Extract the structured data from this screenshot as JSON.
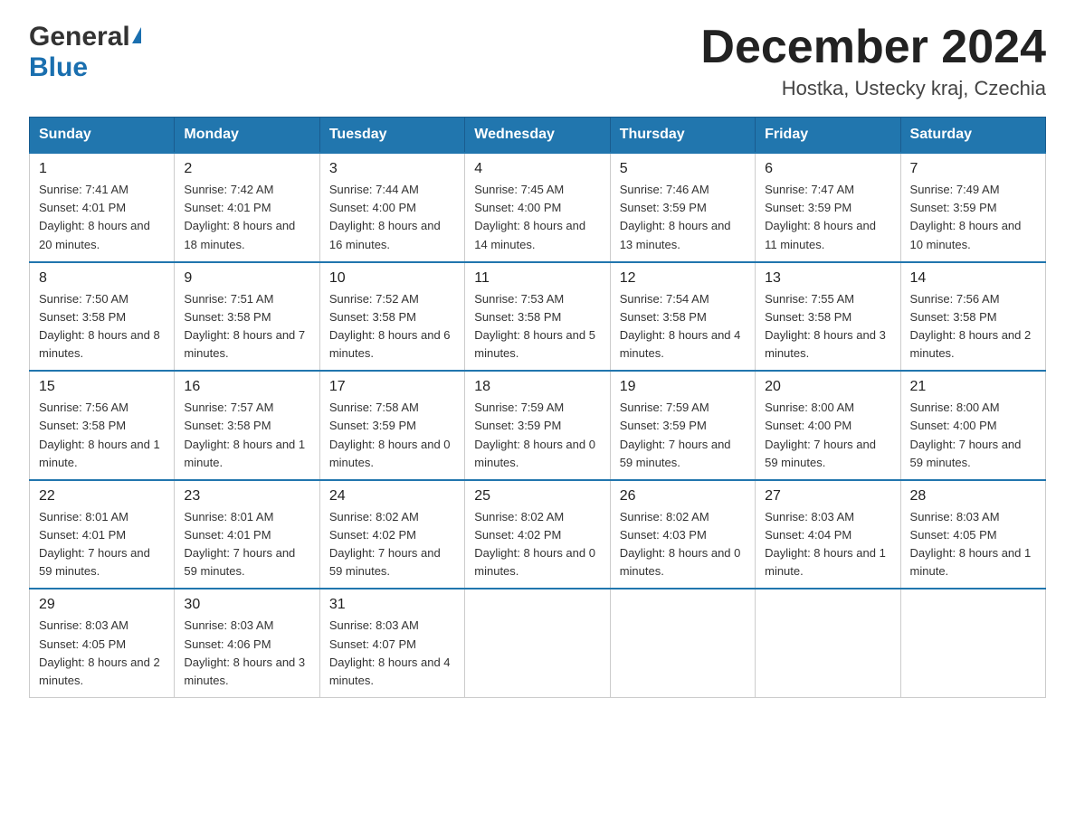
{
  "header": {
    "logo_general": "General",
    "logo_blue": "Blue",
    "month_title": "December 2024",
    "location": "Hostka, Ustecky kraj, Czechia"
  },
  "days_of_week": [
    "Sunday",
    "Monday",
    "Tuesday",
    "Wednesday",
    "Thursday",
    "Friday",
    "Saturday"
  ],
  "weeks": [
    [
      {
        "day": "1",
        "sunrise": "7:41 AM",
        "sunset": "4:01 PM",
        "daylight": "8 hours and 20 minutes."
      },
      {
        "day": "2",
        "sunrise": "7:42 AM",
        "sunset": "4:01 PM",
        "daylight": "8 hours and 18 minutes."
      },
      {
        "day": "3",
        "sunrise": "7:44 AM",
        "sunset": "4:00 PM",
        "daylight": "8 hours and 16 minutes."
      },
      {
        "day": "4",
        "sunrise": "7:45 AM",
        "sunset": "4:00 PM",
        "daylight": "8 hours and 14 minutes."
      },
      {
        "day": "5",
        "sunrise": "7:46 AM",
        "sunset": "3:59 PM",
        "daylight": "8 hours and 13 minutes."
      },
      {
        "day": "6",
        "sunrise": "7:47 AM",
        "sunset": "3:59 PM",
        "daylight": "8 hours and 11 minutes."
      },
      {
        "day": "7",
        "sunrise": "7:49 AM",
        "sunset": "3:59 PM",
        "daylight": "8 hours and 10 minutes."
      }
    ],
    [
      {
        "day": "8",
        "sunrise": "7:50 AM",
        "sunset": "3:58 PM",
        "daylight": "8 hours and 8 minutes."
      },
      {
        "day": "9",
        "sunrise": "7:51 AM",
        "sunset": "3:58 PM",
        "daylight": "8 hours and 7 minutes."
      },
      {
        "day": "10",
        "sunrise": "7:52 AM",
        "sunset": "3:58 PM",
        "daylight": "8 hours and 6 minutes."
      },
      {
        "day": "11",
        "sunrise": "7:53 AM",
        "sunset": "3:58 PM",
        "daylight": "8 hours and 5 minutes."
      },
      {
        "day": "12",
        "sunrise": "7:54 AM",
        "sunset": "3:58 PM",
        "daylight": "8 hours and 4 minutes."
      },
      {
        "day": "13",
        "sunrise": "7:55 AM",
        "sunset": "3:58 PM",
        "daylight": "8 hours and 3 minutes."
      },
      {
        "day": "14",
        "sunrise": "7:56 AM",
        "sunset": "3:58 PM",
        "daylight": "8 hours and 2 minutes."
      }
    ],
    [
      {
        "day": "15",
        "sunrise": "7:56 AM",
        "sunset": "3:58 PM",
        "daylight": "8 hours and 1 minute."
      },
      {
        "day": "16",
        "sunrise": "7:57 AM",
        "sunset": "3:58 PM",
        "daylight": "8 hours and 1 minute."
      },
      {
        "day": "17",
        "sunrise": "7:58 AM",
        "sunset": "3:59 PM",
        "daylight": "8 hours and 0 minutes."
      },
      {
        "day": "18",
        "sunrise": "7:59 AM",
        "sunset": "3:59 PM",
        "daylight": "8 hours and 0 minutes."
      },
      {
        "day": "19",
        "sunrise": "7:59 AM",
        "sunset": "3:59 PM",
        "daylight": "7 hours and 59 minutes."
      },
      {
        "day": "20",
        "sunrise": "8:00 AM",
        "sunset": "4:00 PM",
        "daylight": "7 hours and 59 minutes."
      },
      {
        "day": "21",
        "sunrise": "8:00 AM",
        "sunset": "4:00 PM",
        "daylight": "7 hours and 59 minutes."
      }
    ],
    [
      {
        "day": "22",
        "sunrise": "8:01 AM",
        "sunset": "4:01 PM",
        "daylight": "7 hours and 59 minutes."
      },
      {
        "day": "23",
        "sunrise": "8:01 AM",
        "sunset": "4:01 PM",
        "daylight": "7 hours and 59 minutes."
      },
      {
        "day": "24",
        "sunrise": "8:02 AM",
        "sunset": "4:02 PM",
        "daylight": "7 hours and 59 minutes."
      },
      {
        "day": "25",
        "sunrise": "8:02 AM",
        "sunset": "4:02 PM",
        "daylight": "8 hours and 0 minutes."
      },
      {
        "day": "26",
        "sunrise": "8:02 AM",
        "sunset": "4:03 PM",
        "daylight": "8 hours and 0 minutes."
      },
      {
        "day": "27",
        "sunrise": "8:03 AM",
        "sunset": "4:04 PM",
        "daylight": "8 hours and 1 minute."
      },
      {
        "day": "28",
        "sunrise": "8:03 AM",
        "sunset": "4:05 PM",
        "daylight": "8 hours and 1 minute."
      }
    ],
    [
      {
        "day": "29",
        "sunrise": "8:03 AM",
        "sunset": "4:05 PM",
        "daylight": "8 hours and 2 minutes."
      },
      {
        "day": "30",
        "sunrise": "8:03 AM",
        "sunset": "4:06 PM",
        "daylight": "8 hours and 3 minutes."
      },
      {
        "day": "31",
        "sunrise": "8:03 AM",
        "sunset": "4:07 PM",
        "daylight": "8 hours and 4 minutes."
      },
      null,
      null,
      null,
      null
    ]
  ]
}
